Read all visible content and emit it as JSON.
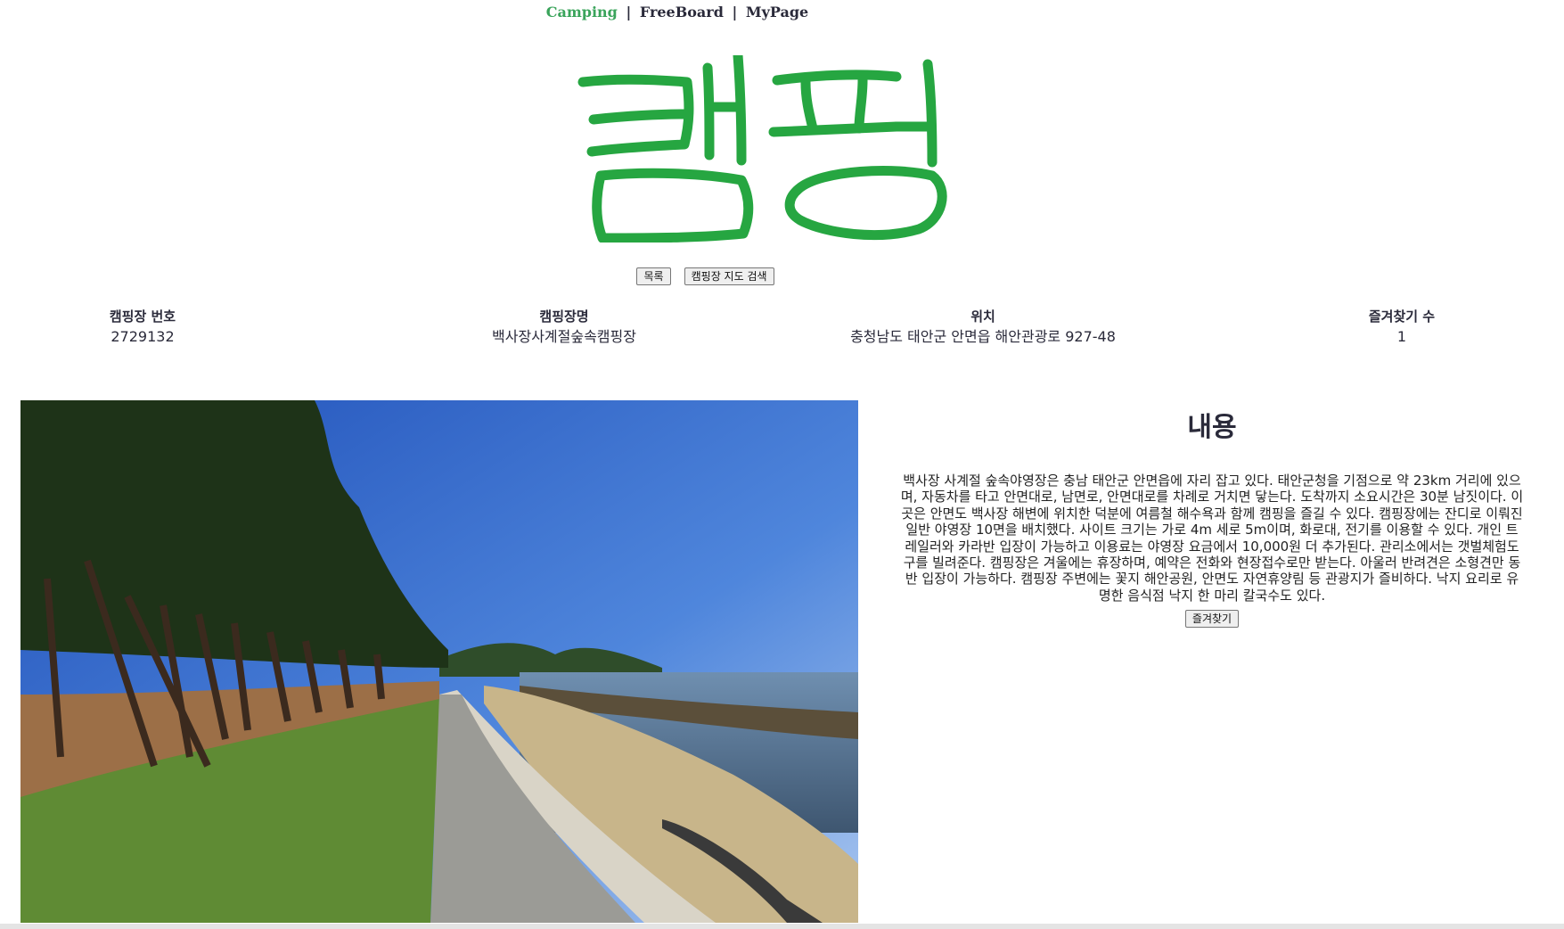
{
  "nav": {
    "camping": "Camping",
    "freeboard": "FreeBoard",
    "mypage": "MyPage",
    "separator": "|",
    "active_color": "#3aa45b"
  },
  "logo": {
    "text": "캠핑",
    "color": "#26a641"
  },
  "buttons": {
    "list": "목록",
    "map_search": "캠핑장 지도 검색",
    "favorite": "즐겨찾기"
  },
  "info": {
    "number_label": "캠핑장 번호",
    "number_value": "2729132",
    "name_label": "캠핑장명",
    "name_value": "백사장사계절숲속캠핑장",
    "location_label": "위치",
    "location_value": "충청남도 태안군 안면읍 해안관광로 927-48",
    "favorites_label": "즐겨찾기 수",
    "favorites_value": "1"
  },
  "content": {
    "title": "내용",
    "body": "백사장 사계절 숲속야영장은 충남 태안군 안면읍에 자리 잡고 있다. 태안군청을 기점으로 약 23km 거리에 있으며, 자동차를 타고 안면대로, 남면로, 안면대로를 차례로 거치면 닿는다. 도착까지 소요시간은 30분 남짓이다. 이곳은 안면도 백사장 해변에 위치한 덕분에 여름철 해수욕과 함께 캠핑을 즐길 수 있다. 캠핑장에는 잔디로 이뤄진 일반 야영장 10면을 배치했다. 사이트 크기는 가로 4m 세로 5m이며, 화로대, 전기를 이용할 수 있다. 개인 트레일러와 카라반 입장이 가능하고 이용료는 야영장 요금에서 10,000원 더 추가된다. 관리소에서는 갯벌체험도구를 빌려준다. 캠핑장은 겨울에는 휴장하며, 예약은 전화와 현장접수로만 받는다. 아울러 반려견은 소형견만 동반 입장이 가능하다. 캠핑장 주변에는 꽃지 해안공원, 안면도 자연휴양림 등 관광지가 즐비하다. 낙지 요리로 유명한 음식점 낙지 한 마리 칼국수도 있다."
  }
}
